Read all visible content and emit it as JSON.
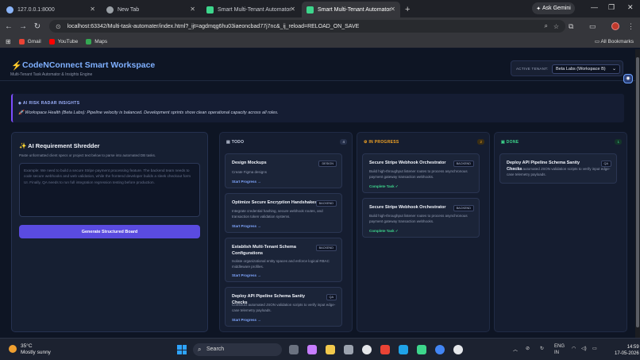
{
  "browser": {
    "tabs": [
      {
        "label": "127.0.0.1:8000",
        "color": "#8ab4f8"
      },
      {
        "label": "New Tab",
        "color": "#9aa0a6"
      },
      {
        "label": "Smart Multi-Tenant Automator",
        "color": "#3dd68c"
      },
      {
        "label": "Smart Multi-Tenant Automator",
        "color": "#3dd68c"
      }
    ],
    "ask_gemini": "Ask Gemini",
    "url": "localhost:63342/Multi-task-automater/index.html?_ijt=agdmqg6hu03iaeoncbad77j7nc&_ij_reload=RELOAD_ON_SAVE",
    "bookmarks": [
      {
        "label": "Gmail",
        "color": "#ea4335"
      },
      {
        "label": "YouTube",
        "color": "#ff0000"
      },
      {
        "label": "Maps",
        "color": "#34a853"
      }
    ],
    "all_bookmarks": "All Bookmarks"
  },
  "header": {
    "title": "CodeNConnect Smart Workspace",
    "subtitle": "Multi-Tenant Task Automator & Insights Engine",
    "tenant_label": "ACTIVE TENANT:",
    "tenant_value": "Beta Labs (Workspace B)"
  },
  "radar": {
    "heading": "AI RISK RADAR INSIGHTS",
    "body": "🚀 Workspace Health (Beta Labs): Pipeline velocity is balanced. Development sprints show clean operational capacity across all roles."
  },
  "shredder": {
    "heading": "AI Requirement Shredder",
    "description": "Paste unformatted client specs or project text below to parse into automated DB tasks.",
    "placeholder": "Example: We need to build a secure Stripe payment processing feature. The backend team needs to code secure webhooks and web validation, while the frontend developer builds a sleek checkout form UI. Finally, QA needs to run full integration regression testing before production.",
    "button": "Generate Structured Board"
  },
  "columns": {
    "todo": {
      "title": "TODO",
      "count": "4",
      "color": "#c9d1e4",
      "cards": [
        {
          "title": "Design Mockups",
          "tag": "DESIGN",
          "desc": "Create Figma designs",
          "action": "Start Progress →"
        },
        {
          "title": "Optimize Secure Encryption Handshakes",
          "tag": "BACKEND",
          "desc": "Integrate credential hashing, secure webhook routes, and transaction token validation systems.",
          "action": "Start Progress →"
        },
        {
          "title": "Establish Multi-Tenant Schema Configurations",
          "tag": "BACKEND",
          "desc": "Isolate organizational entity spaces and enforce logical RBAC middleware profiles.",
          "action": "Start Progress →"
        },
        {
          "title": "Deploy API Pipeline Schema Sanity Checks",
          "tag": "QA",
          "desc": "Construct automated JSON validation scripts to verify input edge-case telemetry payloads.",
          "action": "Start Progress →"
        }
      ]
    },
    "progress": {
      "title": "IN PROGRESS",
      "count": "2",
      "color": "#f5a524",
      "cards": [
        {
          "title": "Secure Stripe Webhook Orchestrator",
          "tag": "BACKEND",
          "desc": "Build high-throughput listener routes to process asynchronous payment gateway transaction webhooks.",
          "action": "Complete Task ✓"
        },
        {
          "title": "Secure Stripe Webhook Orchestrator",
          "tag": "BACKEND",
          "desc": "Build high-throughput listener routes to process asynchronous payment gateway transaction webhooks.",
          "action": "Complete Task ✓"
        }
      ]
    },
    "done": {
      "title": "DONE",
      "count": "1",
      "color": "#3dd68c",
      "cards": [
        {
          "title": "Deploy API Pipeline Schema Sanity Checks",
          "tag": "QA",
          "desc": "Construct automated JSON validation scripts to verify input edge-case telemetry payloads.",
          "action": ""
        }
      ]
    }
  },
  "taskbar": {
    "temp": "35°C",
    "condition": "Mostly sunny",
    "search": "Search",
    "lang": "ENG",
    "region": "IN",
    "time": "14:59",
    "date": "17-05-2026"
  }
}
